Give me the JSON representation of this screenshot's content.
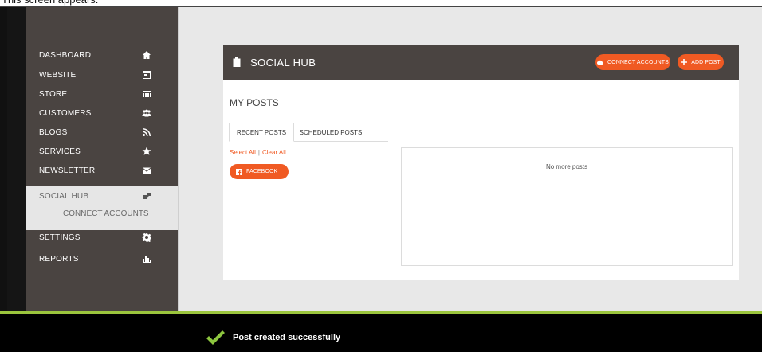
{
  "caption": "This screen appears:",
  "sidebar": {
    "items": [
      {
        "label": "DASHBOARD",
        "icon": "home-icon"
      },
      {
        "label": "WEBSITE",
        "icon": "window-icon"
      },
      {
        "label": "STORE",
        "icon": "store-icon"
      },
      {
        "label": "CUSTOMERS",
        "icon": "users-icon"
      },
      {
        "label": "BLOGS",
        "icon": "rss-icon"
      },
      {
        "label": "SERVICES",
        "icon": "star-icon"
      },
      {
        "label": "NEWSLETTER",
        "icon": "envelope-icon"
      },
      {
        "label": "SOCIAL HUB",
        "icon": "social-hub-icon",
        "active": true
      },
      {
        "label": "SETTINGS",
        "icon": "gear-icon"
      },
      {
        "label": "REPORTS",
        "icon": "bar-chart-icon"
      }
    ],
    "sub_item": "CONNECT ACCOUNTS"
  },
  "panel": {
    "title": "SOCIAL HUB",
    "title_icon": "clipboard-icon",
    "connect_button": "CONNECT ACCOUNTS",
    "add_button": "ADD POST",
    "section_title": "MY POSTS",
    "tabs": [
      {
        "label": "RECENT POSTS",
        "active": true
      },
      {
        "label": "SCHEDULED POSTS",
        "active": false
      }
    ],
    "select_all": "Select All",
    "divider": "|",
    "clear_all": "Clear All",
    "facebook_button": "FACEBOOK",
    "empty_message": "No more posts"
  },
  "toast": {
    "message": "Post created successfully"
  },
  "colors": {
    "sidebar": "#4a4441",
    "accent": "#f05a23",
    "success": "#9bc53d",
    "main_bg": "#e8e8e8"
  }
}
